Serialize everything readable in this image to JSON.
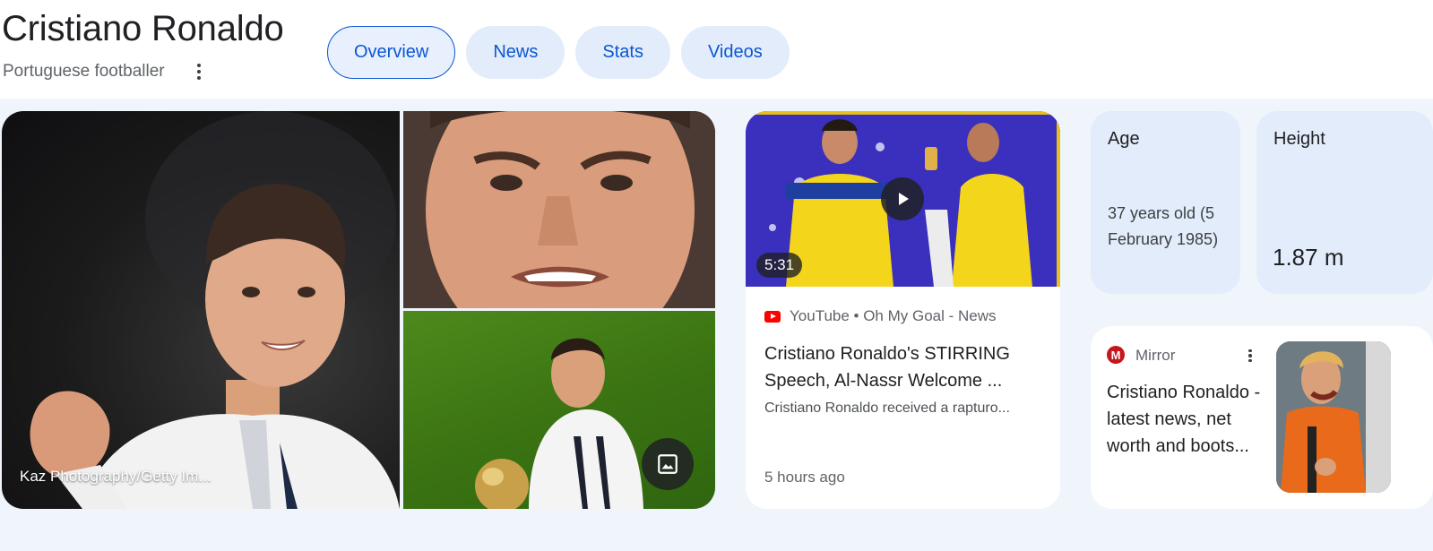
{
  "header": {
    "title": "Cristiano Ronaldo",
    "subtitle": "Portuguese footballer"
  },
  "tabs": [
    {
      "label": "Overview",
      "active": true
    },
    {
      "label": "News",
      "active": false
    },
    {
      "label": "Stats",
      "active": false
    },
    {
      "label": "Videos",
      "active": false
    }
  ],
  "images": {
    "main_credit": "Kaz Photography/Getty Im..."
  },
  "video": {
    "duration": "5:31",
    "source": "YouTube • Oh My Goal - News",
    "title": "Cristiano Ronaldo's STIRRING Speech, Al-Nassr Welcome ...",
    "description": "Cristiano Ronaldo received a rapturo...",
    "time": "5 hours ago"
  },
  "facts": {
    "age_label": "Age",
    "age_value": "37 years old (5 February 1985)",
    "height_label": "Height",
    "height_value": "1.87 m"
  },
  "news": {
    "source": "Mirror",
    "logo_letter": "M",
    "title": "Cristiano Ronaldo - latest news, net worth and boots..."
  },
  "colors": {
    "accent": "#0b57d0",
    "tab_bg": "#e3ecfa",
    "band_bg": "#f0f4fb",
    "youtube_red": "#ff0000",
    "mirror_red": "#c4161c"
  }
}
